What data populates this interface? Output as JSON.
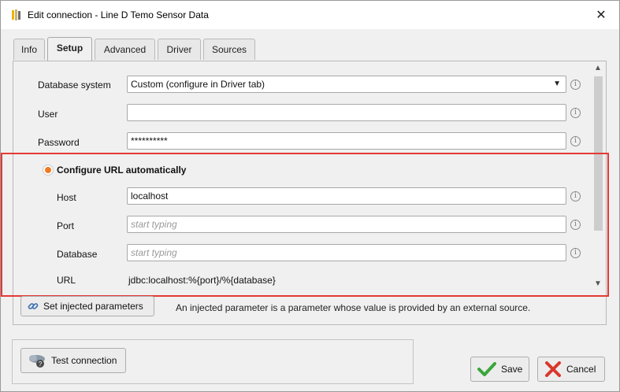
{
  "window": {
    "title": "Edit connection - Line D Temo Sensor Data",
    "close_glyph": "✕",
    "icon": "app-logo-icon"
  },
  "tabs": [
    {
      "label": "Info",
      "active": false
    },
    {
      "label": "Setup",
      "active": true
    },
    {
      "label": "Advanced",
      "active": false
    },
    {
      "label": "Driver",
      "active": false
    },
    {
      "label": "Sources",
      "active": false
    }
  ],
  "form": {
    "database_system": {
      "label": "Database system",
      "value": "Custom (configure in Driver tab)"
    },
    "user": {
      "label": "User",
      "value": ""
    },
    "password": {
      "label": "Password",
      "value": "**********"
    },
    "configure_url": {
      "label": "Configure URL automatically",
      "selected": true
    },
    "host": {
      "label": "Host",
      "value": "localhost"
    },
    "port": {
      "label": "Port",
      "value": "",
      "placeholder": "start typing"
    },
    "database": {
      "label": "Database",
      "value": "",
      "placeholder": "start typing"
    },
    "url": {
      "label": "URL",
      "value": "jdbc:localhost:%{port}/%{database}"
    }
  },
  "injected": {
    "button_label": "Set injected parameters",
    "note": "An injected parameter is a parameter whose value is provided by an external source."
  },
  "footer": {
    "test_connection": "Test connection",
    "save": "Save",
    "cancel": "Cancel"
  },
  "colors": {
    "accent_orange": "#f07b23",
    "highlight_red": "#e53935",
    "save_check": "#3aa53a",
    "cancel_x": "#d9362b"
  },
  "info_glyph": "i"
}
